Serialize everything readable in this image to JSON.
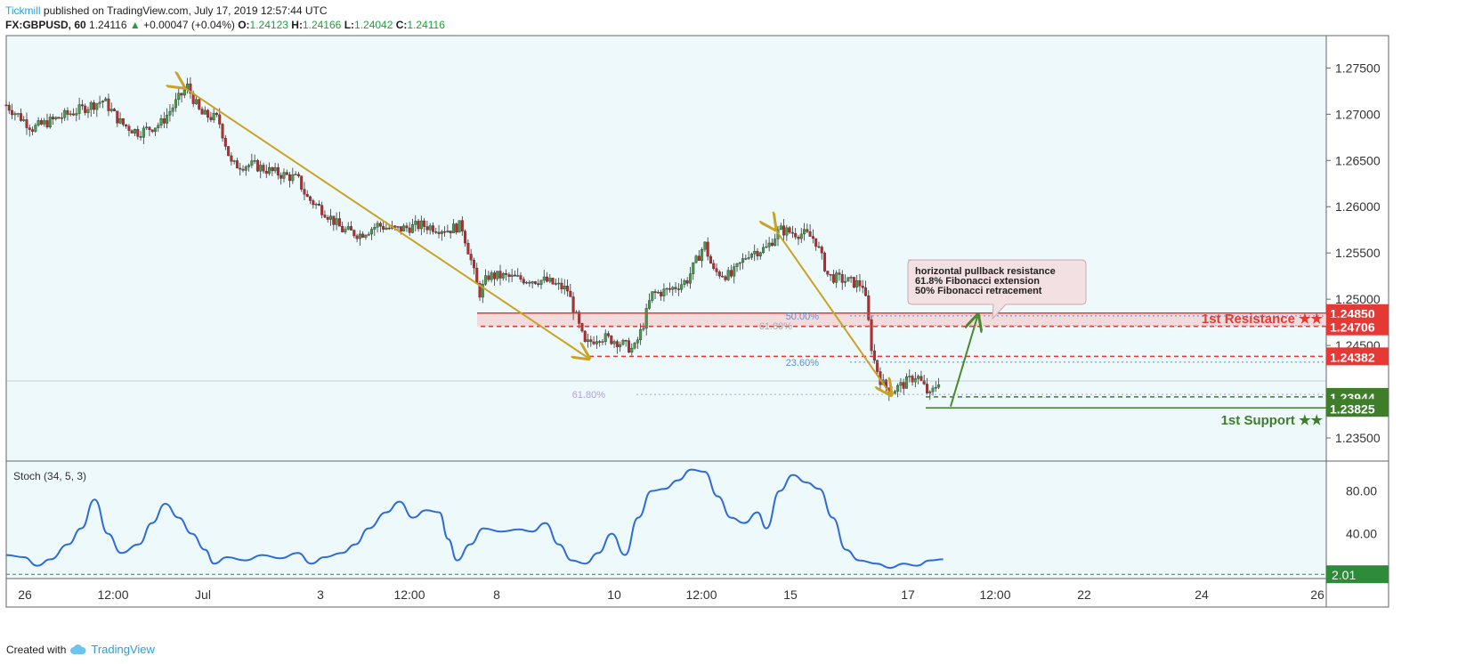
{
  "header": {
    "publisher": "Tickmill",
    "published_text": "published on TradingView.com, July 17, 2019 12:57:44 UTC",
    "symbol": "FX:GBPUSD, 60",
    "last": "1.24116",
    "change": "+0.00047 (+0.04%)",
    "open_label": "O:",
    "open": "1.24123",
    "high_label": "H:",
    "high": "1.24166",
    "low_label": "L:",
    "low": "1.24042",
    "close_label": "C:",
    "close": "1.24116"
  },
  "footer": {
    "created_with": "Created with",
    "brand": "TradingView"
  },
  "colors": {
    "background": "#eef9fc",
    "up": "#43a047",
    "down": "#c62828",
    "resistance": "#e53935",
    "support": "#3f7d2b",
    "trend_arrow": "#c9a227",
    "stoch_line": "#2e6bd6",
    "fib": "#5b8fd8"
  },
  "chart_data": [
    {
      "type": "candlestick",
      "title": "FX:GBPUSD, 60",
      "x_ticks": [
        "26",
        "12:00",
        "Jul",
        "3",
        "12:00",
        "8",
        "10",
        "12:00",
        "15",
        "17",
        "12:00",
        "22",
        "24",
        "26"
      ],
      "ylim": [
        1.2325,
        1.2785
      ],
      "y_ticks": [
        "1.27500",
        "1.27000",
        "1.26500",
        "1.26000",
        "1.25500",
        "1.25000",
        "1.24500",
        "1.23500"
      ],
      "price_path_approx": [
        [
          0,
          1.271
        ],
        [
          0.03,
          1.2685
        ],
        [
          0.07,
          1.27
        ],
        [
          0.11,
          1.2715
        ],
        [
          0.13,
          1.269
        ],
        [
          0.15,
          1.268
        ],
        [
          0.175,
          1.269
        ],
        [
          0.205,
          1.273
        ],
        [
          0.22,
          1.27
        ],
        [
          0.24,
          1.2695
        ],
        [
          0.255,
          1.2645
        ],
        [
          0.28,
          1.2645
        ],
        [
          0.3,
          1.2638
        ],
        [
          0.33,
          1.263
        ],
        [
          0.34,
          1.261
        ],
        [
          0.36,
          1.2595
        ],
        [
          0.38,
          1.2575
        ],
        [
          0.4,
          1.257
        ],
        [
          0.42,
          1.258
        ],
        [
          0.44,
          1.2575
        ],
        [
          0.47,
          1.258
        ],
        [
          0.5,
          1.2575
        ],
        [
          0.515,
          1.258
        ],
        [
          0.525,
          1.2545
        ],
        [
          0.535,
          1.2505
        ],
        [
          0.545,
          1.2525
        ],
        [
          0.56,
          1.2525
        ],
        [
          0.58,
          1.2522
        ],
        [
          0.61,
          1.252
        ],
        [
          0.635,
          1.251
        ],
        [
          0.645,
          1.248
        ],
        [
          0.655,
          1.245
        ],
        [
          0.67,
          1.246
        ],
        [
          0.69,
          1.2455
        ],
        [
          0.71,
          1.2445
        ],
        [
          0.72,
          1.247
        ],
        [
          0.73,
          1.2505
        ],
        [
          0.75,
          1.251
        ],
        [
          0.77,
          1.252
        ],
        [
          0.79,
          1.256
        ],
        [
          0.8,
          1.253
        ],
        [
          0.82,
          1.2525
        ],
        [
          0.84,
          1.255
        ],
        [
          0.86,
          1.2555
        ],
        [
          0.875,
          1.2575
        ],
        [
          0.89,
          1.2572
        ],
        [
          0.905,
          1.257
        ],
        [
          0.915,
          1.2565
        ],
        [
          0.93,
          1.2525
        ],
        [
          0.95,
          1.252
        ],
        [
          0.97,
          1.2515
        ],
        [
          0.975,
          1.248
        ],
        [
          0.98,
          1.244
        ],
        [
          0.99,
          1.241
        ],
        [
          1.0,
          1.24
        ],
        [
          1.015,
          1.2408
        ],
        [
          1.03,
          1.2418
        ],
        [
          1.045,
          1.2395
        ],
        [
          1.055,
          1.2412
        ]
      ],
      "levels": [
        {
          "name": "1st Resistance ★★",
          "value": 1.2485,
          "style": "solid",
          "color": "#e53935"
        },
        {
          "name": "",
          "value": 1.24706,
          "style": "dashed",
          "color": "#e53935"
        },
        {
          "name": "",
          "value": 1.24382,
          "style": "dashed",
          "color": "#e53935"
        },
        {
          "name": "",
          "value": 1.23944,
          "style": "dashed",
          "color": "#3f7d2b"
        },
        {
          "name": "1st Support ★★",
          "value": 1.23825,
          "style": "solid",
          "color": "#3f7d2b"
        }
      ],
      "price_labels": [
        "1.24850",
        "1.24706",
        "1.24382",
        "1.23944",
        "1.23825"
      ],
      "fibonacci_labels": [
        "50.00%",
        "61.80%",
        "23.60%",
        "61.80%"
      ],
      "annotation": [
        "horizontal pullback resistance",
        "61.8% Fibonacci extension",
        "50% Fibonacci retracement"
      ],
      "resistance_label": "1st Resistance ★★",
      "support_label": "1st Support ★★"
    },
    {
      "type": "line",
      "title": "Stoch (34, 5, 3)",
      "ylim": [
        -2,
        108
      ],
      "y_ticks": [
        "80.00",
        "40.00"
      ],
      "last_value_label": "2.01",
      "last_value": 2.01,
      "series": [
        {
          "values": [
            [
              0,
              20
            ],
            [
              0.02,
              18
            ],
            [
              0.035,
              10
            ],
            [
              0.05,
              16
            ],
            [
              0.07,
              30
            ],
            [
              0.085,
              45
            ],
            [
              0.1,
              72
            ],
            [
              0.115,
              40
            ],
            [
              0.13,
              22
            ],
            [
              0.15,
              30
            ],
            [
              0.165,
              50
            ],
            [
              0.18,
              68
            ],
            [
              0.195,
              55
            ],
            [
              0.21,
              40
            ],
            [
              0.225,
              25
            ],
            [
              0.235,
              12
            ],
            [
              0.25,
              18
            ],
            [
              0.27,
              15
            ],
            [
              0.29,
              20
            ],
            [
              0.31,
              17
            ],
            [
              0.33,
              22
            ],
            [
              0.345,
              12
            ],
            [
              0.36,
              18
            ],
            [
              0.38,
              22
            ],
            [
              0.395,
              30
            ],
            [
              0.41,
              45
            ],
            [
              0.43,
              60
            ],
            [
              0.445,
              70
            ],
            [
              0.46,
              55
            ],
            [
              0.475,
              62
            ],
            [
              0.49,
              60
            ],
            [
              0.5,
              35
            ],
            [
              0.51,
              15
            ],
            [
              0.525,
              30
            ],
            [
              0.54,
              45
            ],
            [
              0.56,
              42
            ],
            [
              0.58,
              44
            ],
            [
              0.595,
              42
            ],
            [
              0.61,
              50
            ],
            [
              0.625,
              30
            ],
            [
              0.64,
              15
            ],
            [
              0.655,
              12
            ],
            [
              0.67,
              22
            ],
            [
              0.685,
              40
            ],
            [
              0.7,
              20
            ],
            [
              0.715,
              55
            ],
            [
              0.73,
              80
            ],
            [
              0.745,
              82
            ],
            [
              0.76,
              90
            ],
            [
              0.775,
              100
            ],
            [
              0.79,
              98
            ],
            [
              0.805,
              75
            ],
            [
              0.82,
              55
            ],
            [
              0.835,
              50
            ],
            [
              0.85,
              60
            ],
            [
              0.86,
              45
            ],
            [
              0.875,
              80
            ],
            [
              0.89,
              95
            ],
            [
              0.905,
              88
            ],
            [
              0.92,
              82
            ],
            [
              0.935,
              55
            ],
            [
              0.95,
              25
            ],
            [
              0.965,
              15
            ],
            [
              0.985,
              12
            ],
            [
              1.0,
              8
            ],
            [
              1.015,
              12
            ],
            [
              1.03,
              10
            ],
            [
              1.045,
              15
            ],
            [
              1.06,
              16
            ]
          ]
        }
      ],
      "hline": 2.01
    }
  ]
}
